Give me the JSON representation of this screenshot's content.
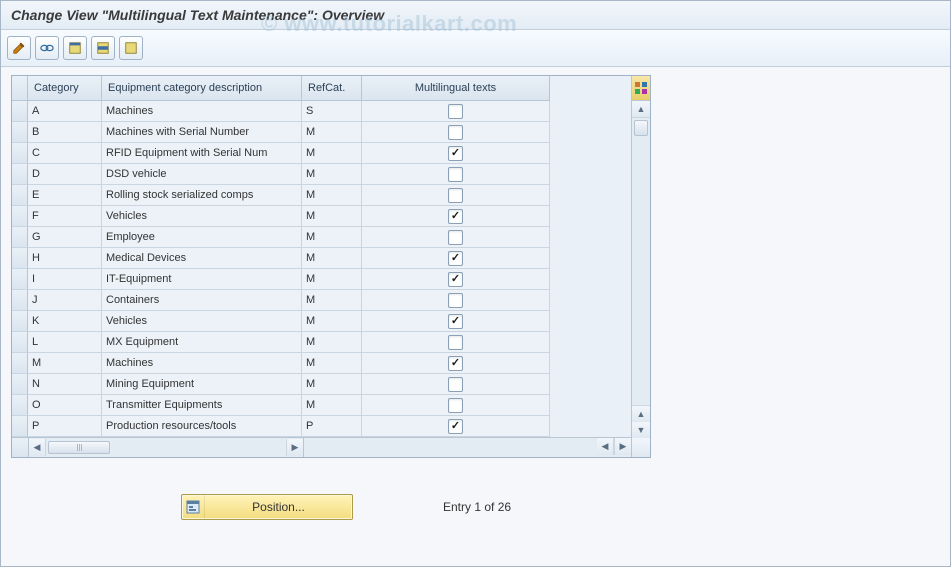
{
  "title": "Change View \"Multilingual Text Maintenance\": Overview",
  "watermark": "© www.tutorialkart.com",
  "toolbar_icons": [
    "toggle-display-change",
    "glasses",
    "select-all",
    "select-block",
    "deselect-all"
  ],
  "columns": {
    "category": "Category",
    "description": "Equipment category description",
    "refcat": "RefCat.",
    "multilingual": "Multilingual texts"
  },
  "rows": [
    {
      "cat": "A",
      "desc": "Machines",
      "ref": "S",
      "ml": false
    },
    {
      "cat": "B",
      "desc": "Machines with Serial Number",
      "ref": "M",
      "ml": false
    },
    {
      "cat": "C",
      "desc": "RFID Equipment with Serial Num",
      "ref": "M",
      "ml": true
    },
    {
      "cat": "D",
      "desc": "DSD vehicle",
      "ref": "M",
      "ml": false
    },
    {
      "cat": "E",
      "desc": "Rolling stock serialized comps",
      "ref": "M",
      "ml": false
    },
    {
      "cat": "F",
      "desc": "Vehicles",
      "ref": "M",
      "ml": true
    },
    {
      "cat": "G",
      "desc": "Employee",
      "ref": "M",
      "ml": false
    },
    {
      "cat": "H",
      "desc": "Medical Devices",
      "ref": "M",
      "ml": true
    },
    {
      "cat": "I",
      "desc": "IT-Equipment",
      "ref": "M",
      "ml": true
    },
    {
      "cat": "J",
      "desc": "Containers",
      "ref": "M",
      "ml": false
    },
    {
      "cat": "K",
      "desc": "Vehicles",
      "ref": "M",
      "ml": true
    },
    {
      "cat": "L",
      "desc": "MX Equipment",
      "ref": "M",
      "ml": false
    },
    {
      "cat": "M",
      "desc": "Machines",
      "ref": "M",
      "ml": true
    },
    {
      "cat": "N",
      "desc": "Mining Equipment",
      "ref": "M",
      "ml": false
    },
    {
      "cat": "O",
      "desc": "Transmitter Equipments",
      "ref": "M",
      "ml": false
    },
    {
      "cat": "P",
      "desc": "Production resources/tools",
      "ref": "P",
      "ml": true
    }
  ],
  "footer": {
    "position_label": "Position...",
    "entry_text": "Entry 1 of 26"
  }
}
